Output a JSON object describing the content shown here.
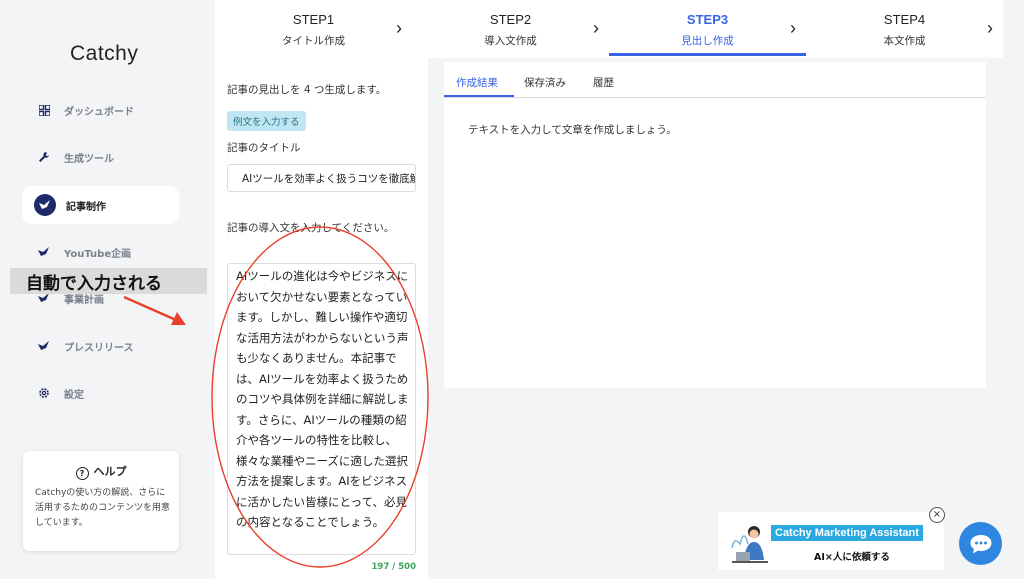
{
  "brand": "Catchy",
  "sidebar": {
    "items": [
      {
        "label": "ダッシュボード",
        "icon": "dashboard-icon"
      },
      {
        "label": "生成ツール",
        "icon": "wrench-icon"
      },
      {
        "label": "記事制作",
        "icon": "bird-icon",
        "active": true
      },
      {
        "label": "YouTube企画",
        "icon": "bird-icon"
      },
      {
        "label": "事業計画",
        "icon": "bird-icon"
      },
      {
        "label": "プレスリリース",
        "icon": "bird-icon"
      },
      {
        "label": "設定",
        "icon": "gear-icon"
      }
    ],
    "help": {
      "title": "ヘルプ",
      "text": "Catchyの使い方の解説、さらに活用するためのコンテンツを用意しています。"
    }
  },
  "steps": [
    {
      "title": "STEP1",
      "sub": "タイトル作成"
    },
    {
      "title": "STEP2",
      "sub": "導入文作成"
    },
    {
      "title": "STEP3",
      "sub": "見出し作成",
      "active": true
    },
    {
      "title": "STEP4",
      "sub": "本文作成"
    }
  ],
  "form": {
    "description": "記事の見出しを 4 つ生成します。",
    "example_button": "例文を入力する",
    "title_label": "記事のタイトル",
    "title_value": "AIツールを効率よく扱うコツを徹底解説",
    "intro_label": "記事の導入文を入力してください。",
    "intro_value": " AIツールの進化は今やビジネスにおいて欠かせない要素となっています。しかし、難しい操作や適切な活用方法がわからないという声も少なくありません。本記事では、AIツールを効率よく扱うためのコツや具体例を詳細に解説します。さらに、AIツールの種類の紹介や各ツールの特性を比較し、様々な業種やニーズに適した選択方法を提案します。AIをビジネスに活かしたい皆様にとって、必見の内容となることでしょう。",
    "counter": "197 / 500"
  },
  "result": {
    "tabs": [
      "作成結果",
      "保存済み",
      "履歴"
    ],
    "active_tab": "作成結果",
    "placeholder": "テキストを入力して文章を作成しましょう。"
  },
  "annotation": {
    "label": "自動で入力される",
    "color": "#e8402a"
  },
  "assistant": {
    "title": "Catchy Marketing Assistant",
    "subtitle": "AI×人に依頼する",
    "close": "×"
  },
  "colors": {
    "accent": "#3a63e6",
    "navy": "#1f2a6b",
    "counter": "#3aa35c",
    "chat": "#2f86e0"
  }
}
